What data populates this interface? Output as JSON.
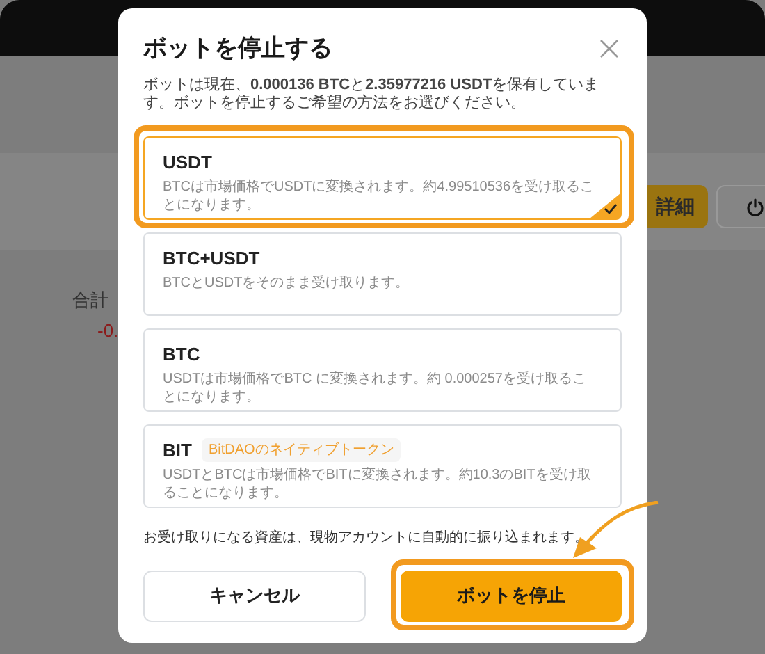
{
  "background": {
    "detail_button": "詳細",
    "total_label": "合計",
    "total_value": "-0."
  },
  "dialog": {
    "title": "ボットを停止する",
    "intro": "ボットは現在、**0.000136 BTC**と**2.35977216 USDT**を保有しています。ボットを停止するご希望の方法をお選びください。",
    "options": [
      {
        "label": "USDT",
        "description": "BTCは市場価格でUSDTに変換されます。約4.99510536を受け取ることになります。",
        "selected": true,
        "highlighted": true
      },
      {
        "label": "BTC+USDT",
        "description": "BTCとUSDTをそのまま受け取ります。",
        "selected": false,
        "highlighted": false
      },
      {
        "label": "BTC",
        "description": "USDTは市場価格でBTC に変換されます。約 0.000257を受け取ることになります。",
        "selected": false,
        "highlighted": false
      },
      {
        "label": "BIT",
        "tag": "BitDAOのネイティブトークン",
        "description": "USDTとBTCは市場価格でBITに変換されます。約10.3のBITを受け取ることになります。",
        "selected": false,
        "highlighted": false
      }
    ],
    "note": "お受け取りになる資産は、現物アカウントに自動的に振り込まれます。",
    "buttons": [
      {
        "kind": "secondary",
        "label": "キャンセル",
        "highlighted": false
      },
      {
        "kind": "primary",
        "label": "ボットを停止",
        "highlighted": true
      }
    ]
  }
}
